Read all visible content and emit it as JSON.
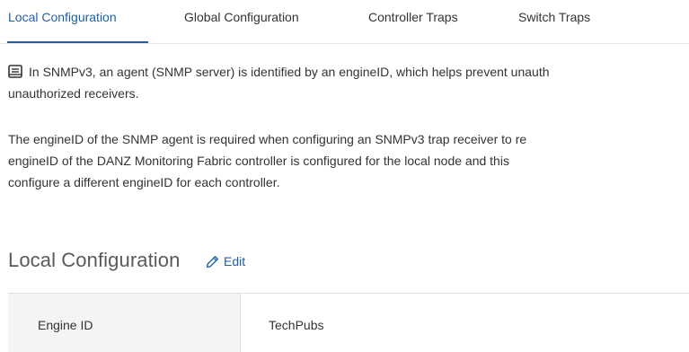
{
  "tabs": [
    {
      "label": "Local Configuration",
      "active": true
    },
    {
      "label": "Global Configuration",
      "active": false
    },
    {
      "label": "Controller Traps",
      "active": false
    },
    {
      "label": "Switch Traps",
      "active": false
    }
  ],
  "note": {
    "icon": "note-icon",
    "paragraph1": [
      "In SNMPv3, an agent (SNMP server) is identified by an engineID, which helps prevent unauth",
      "unauthorized receivers."
    ],
    "paragraph2": [
      "The engineID of the SNMP agent is required when configuring an SNMPv3 trap receiver to re",
      "engineID of the DANZ Monitoring Fabric controller is configured for the local node and this",
      "configure a different engineID for each controller."
    ]
  },
  "section": {
    "title": "Local Configuration",
    "edit_label": "Edit",
    "edit_icon": "pencil-icon"
  },
  "table": {
    "rows": [
      {
        "label": "Engine ID",
        "value": "TechPubs"
      }
    ]
  },
  "colors": {
    "accent": "#1f5fa8",
    "text": "#333333",
    "label_bg": "#f4f4f4",
    "border": "#e3e3e3"
  }
}
